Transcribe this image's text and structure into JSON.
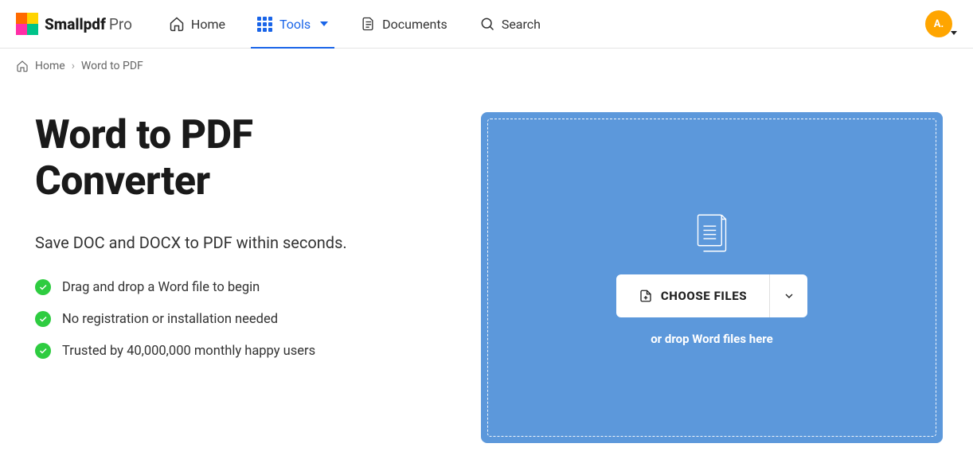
{
  "brand": {
    "name": "Smallpdf",
    "suffix": "Pro"
  },
  "nav": {
    "home": "Home",
    "tools": "Tools",
    "documents": "Documents",
    "search": "Search"
  },
  "avatar_initial": "A.",
  "breadcrumb": {
    "home": "Home",
    "current": "Word to PDF"
  },
  "page": {
    "title": "Word to PDF Converter",
    "subtitle": "Save DOC and DOCX to PDF within seconds.",
    "features": [
      "Drag and drop a Word file to begin",
      "No registration or installation needed",
      "Trusted by 40,000,000 monthly happy users"
    ]
  },
  "dropzone": {
    "choose_label": "CHOOSE FILES",
    "hint": "or drop Word files here"
  },
  "colors": {
    "accent": "#1964e8",
    "dropzone": "#5c98db",
    "success": "#2ecc40",
    "avatar": "#ffa500"
  }
}
